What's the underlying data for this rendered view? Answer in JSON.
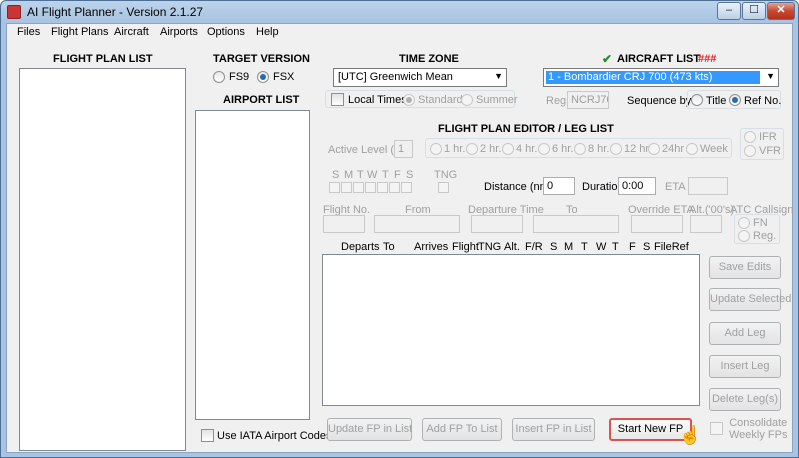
{
  "window": {
    "title": "AI Flight Planner - Version 2.1.27",
    "min": "–",
    "max": "☐",
    "close": "✕"
  },
  "menu": [
    "Files",
    "Flight Plans",
    "Aircraft",
    "Airports",
    "Options",
    "Help"
  ],
  "flight_plan_list": {
    "heading": "FLIGHT PLAN LIST"
  },
  "target_version": {
    "heading": "TARGET VERSION",
    "options": [
      "FS9",
      "FSX"
    ],
    "selected": "FSX"
  },
  "airport_list": {
    "heading": "AIRPORT LIST",
    "iata_label": "Use IATA Airport Codes"
  },
  "time_zone": {
    "heading": "TIME ZONE",
    "value": "[UTC] Greenwich Mean",
    "local_times": "Local Times",
    "standard": "Standard",
    "summer": "Summer"
  },
  "aircraft_list": {
    "check": "✔",
    "heading": "AIRCRAFT LIST",
    "marker": "###",
    "value": "1 - Bombardier CRJ 700 (473 kts)",
    "reg_label": "Reg.",
    "reg_value": "NCRJ70",
    "sequence_label": "Sequence by",
    "seq_title": "Title",
    "seq_ref": "Ref No."
  },
  "editor": {
    "heading": "FLIGHT PLAN EDITOR / LEG LIST",
    "active_level_label": "Active Level (%)",
    "active_level_value": "1",
    "intervals": [
      "1 hr.",
      "2 hr.",
      "4 hr.",
      "6 hr.",
      "8 hr.",
      "12 hr",
      "24hr",
      "Week"
    ],
    "ifr": "IFR",
    "vfr": "VFR",
    "days": [
      "S",
      "M",
      "T",
      "W",
      "T",
      "F",
      "S"
    ],
    "tng": "TNG",
    "distance_label": "Distance (nm)",
    "distance_value": "0",
    "duration_label": "Duration",
    "duration_value": "0:00",
    "eta_label": "ETA",
    "flight_no": "Flight No.",
    "from": "From",
    "departure_time": "Departure Time",
    "to": "To",
    "override_eta": "Override ETA",
    "alt": "Alt.('00's)",
    "atc_callsign": "ATC Callsign",
    "fn": "FN",
    "reg": "Reg."
  },
  "leg_headers": [
    "Departs",
    "To",
    "Arrives",
    "Flight",
    "TNG",
    "Alt.",
    "F/R",
    "S",
    "M",
    "T",
    "W",
    "T",
    "F",
    "S",
    "FileRef"
  ],
  "side_buttons": [
    "Save Edits",
    "Update Selected",
    "Add Leg",
    "Insert Leg",
    "Delete Leg(s)"
  ],
  "bottom_buttons": {
    "update": "Update FP in List",
    "add": "Add FP To List",
    "insert": "Insert FP in List",
    "start": "Start New FP"
  },
  "consolidate": "Consolidate\nWeekly FPs",
  "colors": {
    "accent_check": "#2e8b2e",
    "marker": "#e02020",
    "selection": "#3399ff",
    "focus_border": "#d9534f"
  }
}
